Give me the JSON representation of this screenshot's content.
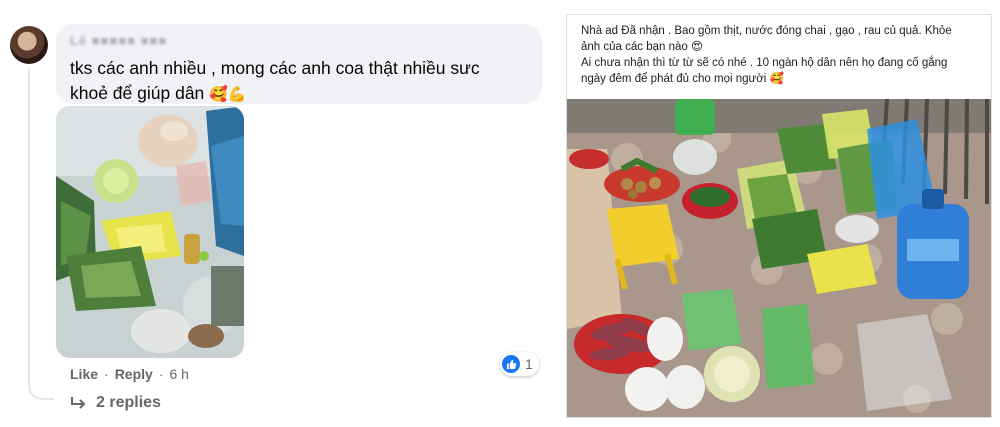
{
  "comment": {
    "author": "Lê ■■■■■ ■■■",
    "text_line1": "tks các anh nhiều , mong các anh coa thật nhiều sưc",
    "text_line2": "khoẻ để giúp dân",
    "emoji": "🥰💪",
    "actions": {
      "like": "Like",
      "dot1": "·",
      "reply": "Reply",
      "dot2": "·",
      "time": "6 h"
    },
    "reaction_count": "1",
    "replies": "2 replies"
  },
  "post": {
    "line1": "Nhà ad Đã nhận . Bao gồm thịt, nước đóng chai , gạo , rau củ quả. Khỏe",
    "line2": "ảnh của các bạn nào 😍",
    "line3": " Ai chưa nhận thì từ từ sẽ có nhé . 10 ngàn hộ dân nên họ đang cố gắng",
    "line4": "ngày đêm để phát đủ cho mọi người 🥰"
  },
  "colors": {
    "bubble": "#f0f2f5",
    "like_blue": "#1877f2",
    "meta_gray": "#65676b"
  }
}
